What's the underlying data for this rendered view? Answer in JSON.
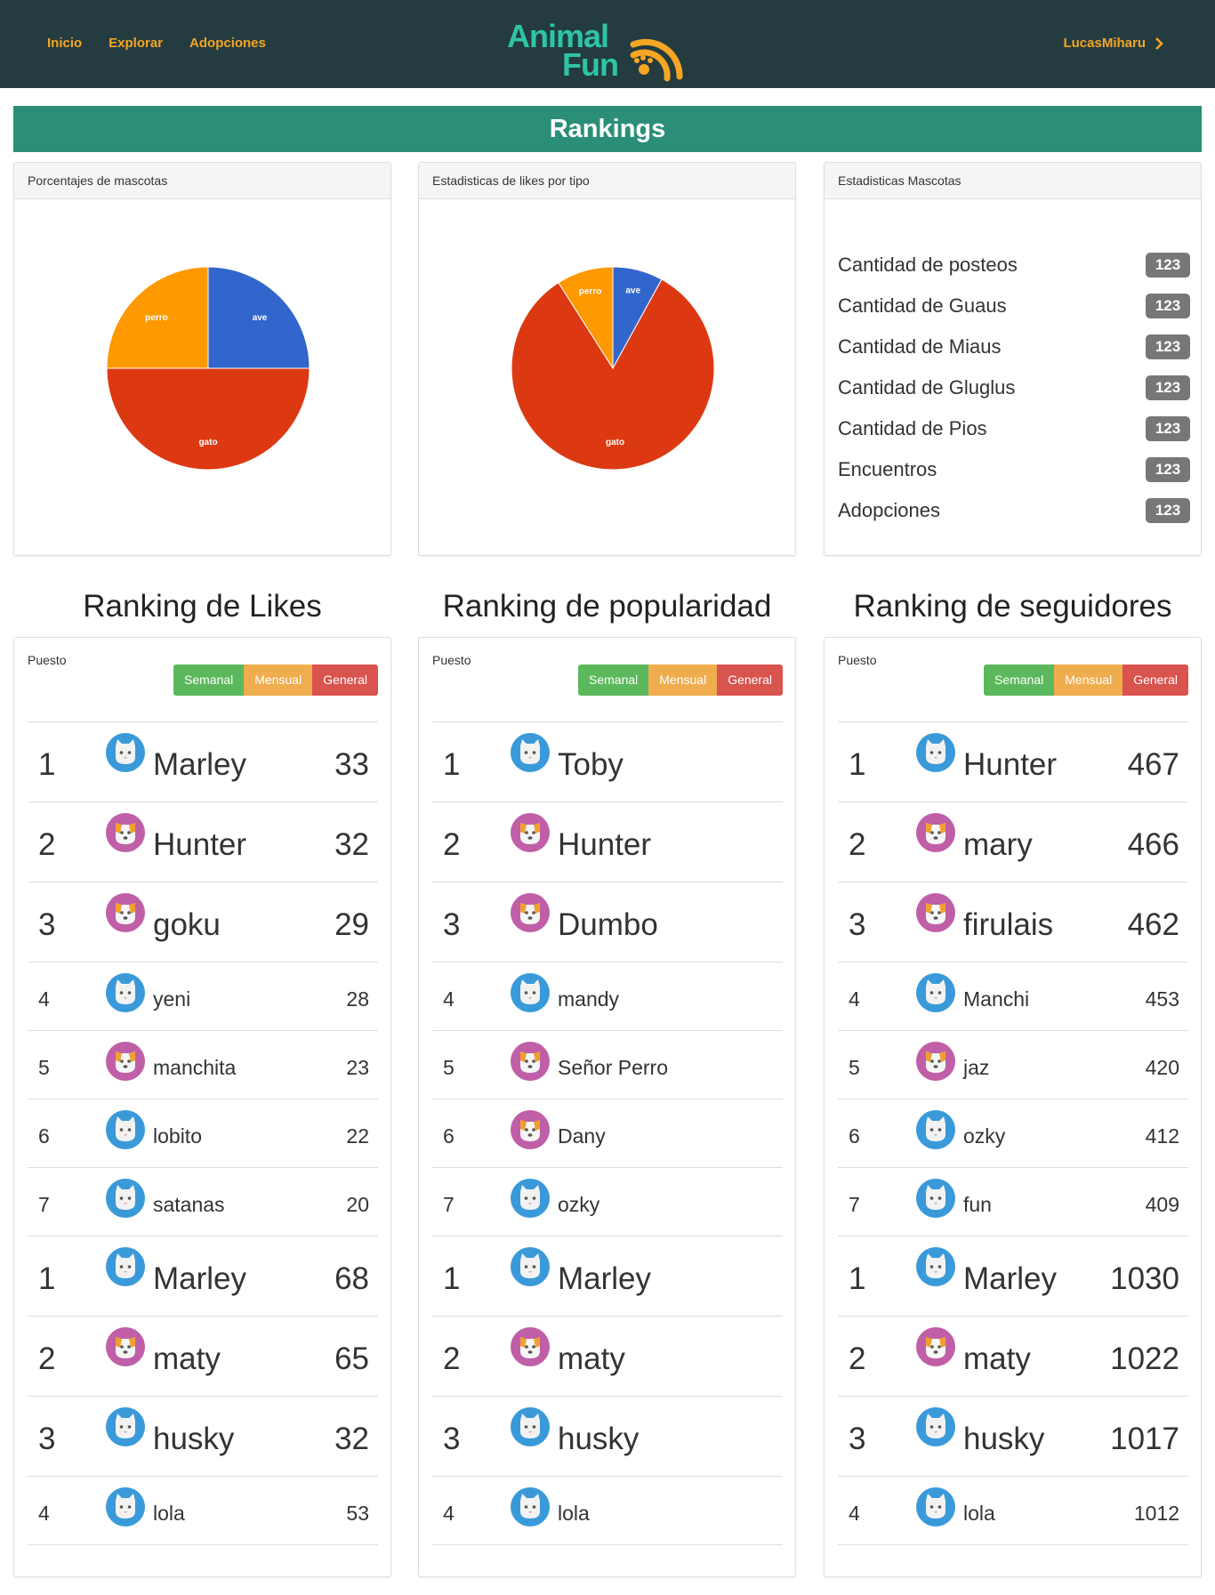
{
  "nav": {
    "links": [
      "Inicio",
      "Explorar",
      "Adopciones"
    ],
    "logo_line1": "Animal",
    "logo_line2": "Fun",
    "user": "LucasMiharu",
    "brand_color": "#2ec4a6",
    "accent_color": "#f5a623"
  },
  "page_title": "Rankings",
  "panels": {
    "pie1_title": "Porcentajes de mascotas",
    "pie2_title": "Estadisticas de likes por tipo",
    "stats_title": "Estadisticas Mascotas"
  },
  "chart_data": [
    {
      "type": "pie",
      "title": "",
      "slices": [
        {
          "label": "ave",
          "value": 25,
          "color": "#3366cc"
        },
        {
          "label": "gato",
          "value": 50,
          "color": "#dc3912"
        },
        {
          "label": "perro",
          "value": 25,
          "color": "#ff9900"
        }
      ]
    },
    {
      "type": "pie",
      "title": "",
      "slices": [
        {
          "label": "ave",
          "value": 8,
          "color": "#3366cc"
        },
        {
          "label": "gato",
          "value": 83,
          "color": "#dc3912"
        },
        {
          "label": "perro",
          "value": 9,
          "color": "#ff9900"
        }
      ]
    }
  ],
  "stats": [
    {
      "label": "Cantidad de posteos",
      "value": "123"
    },
    {
      "label": "Cantidad de Guaus",
      "value": "123"
    },
    {
      "label": "Cantidad de Miaus",
      "value": "123"
    },
    {
      "label": "Cantidad de Gluglus",
      "value": "123"
    },
    {
      "label": "Cantidad de Pios",
      "value": "123"
    },
    {
      "label": "Encuentros",
      "value": "123"
    },
    {
      "label": "Adopciones",
      "value": "123"
    }
  ],
  "ranking_header": {
    "puesto": "Puesto",
    "btn_semanal": "Semanal",
    "btn_mensual": "Mensual",
    "btn_general": "General"
  },
  "rankings": [
    {
      "title": "Ranking de Likes",
      "rows": [
        {
          "pos": "1",
          "name": "Marley",
          "value": "33",
          "avatar": "cat",
          "size": "big"
        },
        {
          "pos": "2",
          "name": "Hunter",
          "value": "32",
          "avatar": "dog",
          "size": "big"
        },
        {
          "pos": "3",
          "name": "goku",
          "value": "29",
          "avatar": "dog",
          "size": "big"
        },
        {
          "pos": "4",
          "name": "yeni",
          "value": "28",
          "avatar": "cat",
          "size": "small"
        },
        {
          "pos": "5",
          "name": "manchita",
          "value": "23",
          "avatar": "dog",
          "size": "small"
        },
        {
          "pos": "6",
          "name": "lobito",
          "value": "22",
          "avatar": "cat",
          "size": "small"
        },
        {
          "pos": "7",
          "name": "satanas",
          "value": "20",
          "avatar": "cat",
          "size": "small"
        },
        {
          "pos": "1",
          "name": "Marley",
          "value": "68",
          "avatar": "cat",
          "size": "big"
        },
        {
          "pos": "2",
          "name": "maty",
          "value": "65",
          "avatar": "dog",
          "size": "big"
        },
        {
          "pos": "3",
          "name": "husky",
          "value": "32",
          "avatar": "cat",
          "size": "big"
        },
        {
          "pos": "4",
          "name": "lola",
          "value": "53",
          "avatar": "cat",
          "size": "small"
        }
      ]
    },
    {
      "title": "Ranking de popularidad",
      "rows": [
        {
          "pos": "1",
          "name": "Toby",
          "value": "",
          "avatar": "cat",
          "size": "big"
        },
        {
          "pos": "2",
          "name": "Hunter",
          "value": "",
          "avatar": "dog",
          "size": "big"
        },
        {
          "pos": "3",
          "name": "Dumbo",
          "value": "",
          "avatar": "dog",
          "size": "big"
        },
        {
          "pos": "4",
          "name": "mandy",
          "value": "",
          "avatar": "cat",
          "size": "small"
        },
        {
          "pos": "5",
          "name": "Señor Perro",
          "value": "",
          "avatar": "dog",
          "size": "small"
        },
        {
          "pos": "6",
          "name": "Dany",
          "value": "",
          "avatar": "dog",
          "size": "small"
        },
        {
          "pos": "7",
          "name": "ozky",
          "value": "",
          "avatar": "cat",
          "size": "small"
        },
        {
          "pos": "1",
          "name": "Marley",
          "value": "",
          "avatar": "cat",
          "size": "big"
        },
        {
          "pos": "2",
          "name": "maty",
          "value": "",
          "avatar": "dog",
          "size": "big"
        },
        {
          "pos": "3",
          "name": "husky",
          "value": "",
          "avatar": "cat",
          "size": "big"
        },
        {
          "pos": "4",
          "name": "lola",
          "value": "",
          "avatar": "cat",
          "size": "small"
        }
      ]
    },
    {
      "title": "Ranking de seguidores",
      "rows": [
        {
          "pos": "1",
          "name": "Hunter",
          "value": "467",
          "avatar": "cat",
          "size": "big"
        },
        {
          "pos": "2",
          "name": "mary",
          "value": "466",
          "avatar": "dog",
          "size": "big"
        },
        {
          "pos": "3",
          "name": "firulais",
          "value": "462",
          "avatar": "dog",
          "size": "big"
        },
        {
          "pos": "4",
          "name": "Manchi",
          "value": "453",
          "avatar": "cat",
          "size": "small"
        },
        {
          "pos": "5",
          "name": "jaz",
          "value": "420",
          "avatar": "dog",
          "size": "small"
        },
        {
          "pos": "6",
          "name": "ozky",
          "value": "412",
          "avatar": "cat",
          "size": "small"
        },
        {
          "pos": "7",
          "name": "fun",
          "value": "409",
          "avatar": "cat",
          "size": "small"
        },
        {
          "pos": "1",
          "name": "Marley",
          "value": "1030",
          "avatar": "cat",
          "size": "big"
        },
        {
          "pos": "2",
          "name": "maty",
          "value": "1022",
          "avatar": "dog",
          "size": "big"
        },
        {
          "pos": "3",
          "name": "husky",
          "value": "1017",
          "avatar": "cat",
          "size": "big"
        },
        {
          "pos": "4",
          "name": "lola",
          "value": "1012",
          "avatar": "cat",
          "size": "small"
        }
      ]
    }
  ]
}
